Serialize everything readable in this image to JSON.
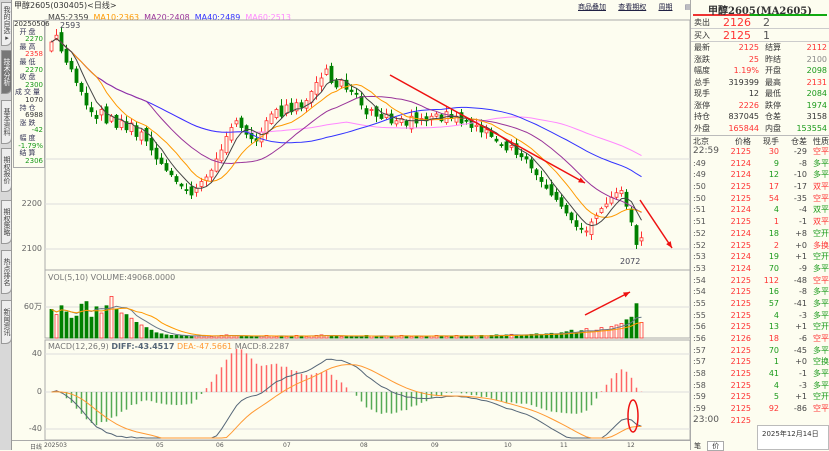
{
  "window": {
    "title": "甲醇2605(030405)<日线>",
    "links": [
      "商品叠加",
      "查看期权",
      "周期"
    ]
  },
  "side_tabs": [
    "我的自选▸",
    "技术分析",
    "基本资料",
    "期权报价",
    "期权策略",
    "热点排名",
    "新闻资讯"
  ],
  "ma_legend": [
    {
      "label": "MA5:2359",
      "color": "#444444"
    },
    {
      "label": "MA10:2363",
      "color": "#ff9900"
    },
    {
      "label": "MA20:2408",
      "color": "#993399"
    },
    {
      "label": "MA40:2489",
      "color": "#3333ff"
    },
    {
      "label": "MA60:2513",
      "color": "#ff88ff"
    }
  ],
  "info_panel": {
    "date": "20250506",
    "items": [
      {
        "label": "开盘",
        "value": "2270",
        "color": "#1a9a1a"
      },
      {
        "label": "最高",
        "value": "2358",
        "color": "#ff3333"
      },
      {
        "label": "最低",
        "value": "2270",
        "color": "#1a9a1a"
      },
      {
        "label": "收盘",
        "value": "2300",
        "color": "#1a9a1a"
      },
      {
        "label": "成交量",
        "value": "1070",
        "color": "#333333"
      },
      {
        "label": "持仓",
        "value": "6988",
        "color": "#333333"
      },
      {
        "label": "涨跌",
        "value": "-42",
        "color": "#1a9a1a"
      },
      {
        "label": "幅度",
        "value": "-1.79%",
        "color": "#1a9a1a"
      },
      {
        "label": "结算",
        "value": "2306",
        "color": "#1a9a1a"
      }
    ]
  },
  "price_axis": {
    "labels": [
      "2300",
      "2200",
      "2100"
    ]
  },
  "annotations": {
    "high_label": "2593",
    "low_label": "2072"
  },
  "chart_data": {
    "type": "candlestick",
    "x_labels": [
      "日线",
      "202503",
      "05",
      "06",
      "07",
      "08",
      "09",
      "10",
      "11",
      "12"
    ],
    "close": [
      2560,
      2575,
      2540,
      2515,
      2500,
      2470,
      2450,
      2420,
      2405,
      2390,
      2410,
      2380,
      2395,
      2370,
      2385,
      2365,
      2380,
      2350,
      2360,
      2340,
      2320,
      2300,
      2290,
      2275,
      2265,
      2250,
      2240,
      2230,
      2220,
      2235,
      2250,
      2260,
      2275,
      2300,
      2320,
      2350,
      2370,
      2385,
      2370,
      2355,
      2345,
      2340,
      2360,
      2385,
      2400,
      2410,
      2395,
      2420,
      2405,
      2425,
      2415,
      2430,
      2450,
      2470,
      2480,
      2500,
      2470,
      2460,
      2475,
      2455,
      2450,
      2445,
      2420,
      2400,
      2410,
      2395,
      2390,
      2400,
      2380,
      2385,
      2390,
      2375,
      2395,
      2380,
      2390,
      2385,
      2395,
      2400,
      2385,
      2405,
      2390,
      2395,
      2380,
      2385,
      2370,
      2375,
      2360,
      2365,
      2350,
      2340,
      2330,
      2320,
      2330,
      2310,
      2305,
      2300,
      2280,
      2265,
      2250,
      2235,
      2220,
      2210,
      2195,
      2180,
      2165,
      2150,
      2145,
      2140,
      2160,
      2175,
      2190,
      2200,
      2215,
      2225,
      2230,
      2195,
      2160,
      2110,
      2125
    ],
    "volume_wan": [
      55,
      45,
      62,
      50,
      38,
      42,
      65,
      70,
      40,
      60,
      48,
      62,
      80,
      55,
      48,
      45,
      38,
      30,
      25,
      20,
      15,
      10,
      8,
      6,
      5,
      5,
      4,
      4,
      3,
      4,
      5,
      4,
      3,
      4,
      5,
      6,
      5,
      4,
      3,
      4,
      3,
      3,
      4,
      5,
      4,
      3,
      4,
      3,
      4,
      5,
      4,
      3,
      4,
      5,
      6,
      5,
      4,
      4,
      3,
      4,
      3,
      3,
      4,
      5,
      4,
      3,
      4,
      4,
      3,
      4,
      5,
      4,
      3,
      4,
      3,
      4,
      4,
      5,
      4,
      3,
      4,
      5,
      4,
      4,
      3,
      4,
      5,
      4,
      5,
      6,
      5,
      6,
      7,
      6,
      5,
      6,
      7,
      8,
      7,
      8,
      9,
      8,
      10,
      12,
      15,
      10,
      14,
      18,
      12,
      15,
      20,
      16,
      22,
      25,
      28,
      35,
      40,
      66,
      30
    ],
    "volume_axis": {
      "label": "60万",
      "value": 60
    },
    "volume_legend": "VOL(5,10) VOLUME:49068.0000",
    "macd_legend": {
      "name": "MACD(12,26,9)",
      "diff": "DIFF:-43.4517",
      "dea": "DEA:-47.5661",
      "macd": "MACD:8.2287"
    },
    "macd_axis": [
      "40",
      "0",
      "-40"
    ],
    "colors": {
      "up": "#ff3232",
      "down": "#008000",
      "ma5": "#444444",
      "ma10": "#ff9900",
      "ma20": "#993399",
      "ma40": "#3333ff",
      "ma60": "#ff88ff",
      "diff": "#556677",
      "dea": "#ff9933"
    }
  },
  "quote": {
    "title": "甲醇2605(MA2605)",
    "sell": {
      "label": "卖出",
      "price": "2126",
      "qty": "2"
    },
    "buy": {
      "label": "买入",
      "price": "2125",
      "qty": "1"
    },
    "stats": [
      [
        "最新",
        "2125",
        "red",
        "结算",
        "2112",
        "red"
      ],
      [
        "涨跌",
        "25",
        "red",
        "昨结",
        "2100",
        "gry"
      ],
      [
        "幅度",
        "1.19%",
        "red",
        "开盘",
        "2098",
        "grn"
      ],
      [
        "总手",
        "319399",
        "",
        "最高",
        "2131",
        "red"
      ],
      [
        "现手",
        "12",
        "",
        "最低",
        "2084",
        "grn"
      ],
      [
        "涨停",
        "2226",
        "red",
        "跌停",
        "1974",
        "grn"
      ],
      [
        "持仓",
        "837045",
        "",
        "仓差",
        "3158",
        ""
      ],
      [
        "外盘",
        "165844",
        "red",
        "内盘",
        "153554",
        "grn"
      ]
    ],
    "trade_header": [
      "北京",
      "价格",
      "现手",
      "仓差",
      "性质"
    ],
    "trades": [
      [
        "22:59",
        "2125",
        "30",
        "-29",
        "空平",
        "red"
      ],
      [
        ":49",
        "2124",
        "9",
        "-8",
        "多平",
        "grn"
      ],
      [
        ":49",
        "2124",
        "12",
        "-10",
        "多平",
        "grn"
      ],
      [
        ":50",
        "2125",
        "17",
        "-17",
        "双平",
        "red"
      ],
      [
        ":50",
        "2125",
        "54",
        "-35",
        "空平",
        "red"
      ],
      [
        ":51",
        "2124",
        "4",
        "-4",
        "双平",
        "grn"
      ],
      [
        ":51",
        "2125",
        "1",
        "-1",
        "双平",
        "red"
      ],
      [
        ":52",
        "2124",
        "18",
        "+8",
        "空开",
        "grn"
      ],
      [
        ":52",
        "2125",
        "2",
        "+0",
        "多换",
        "red"
      ],
      [
        ":53",
        "2124",
        "19",
        "+1",
        "空开",
        "grn"
      ],
      [
        ":53",
        "2124",
        "70",
        "-9",
        "多平",
        "grn"
      ],
      [
        ":54",
        "2125",
        "112",
        "-48",
        "空平",
        "red"
      ],
      [
        ":54",
        "2125",
        "16",
        "-8",
        "多平",
        "grn"
      ],
      [
        ":55",
        "2125",
        "57",
        "-41",
        "多平",
        "grn"
      ],
      [
        ":55",
        "2125",
        "4",
        "-3",
        "多平",
        "grn"
      ],
      [
        ":56",
        "2125",
        "13",
        "+1",
        "空开",
        "grn"
      ],
      [
        ":56",
        "2126",
        "18",
        "-6",
        "空平",
        "red"
      ],
      [
        ":57",
        "2125",
        "70",
        "-45",
        "多平",
        "grn"
      ],
      [
        ":57",
        "2125",
        "1",
        "+0",
        "空换",
        "grn"
      ],
      [
        ":58",
        "2125",
        "41",
        "-1",
        "多平",
        "grn"
      ],
      [
        ":58",
        "2125",
        "4",
        "-3",
        "多平",
        "grn"
      ],
      [
        ":59",
        "2125",
        "5",
        "+1",
        "空开",
        "grn"
      ],
      [
        ":59",
        "2125",
        "92",
        "-86",
        "空平",
        "red"
      ],
      [
        "23:00",
        "2125",
        "",
        "",
        "",
        "red"
      ]
    ],
    "bottom_tabs": [
      "笔",
      "价"
    ]
  },
  "tooltip": {
    "date": "2025年12月14日"
  }
}
